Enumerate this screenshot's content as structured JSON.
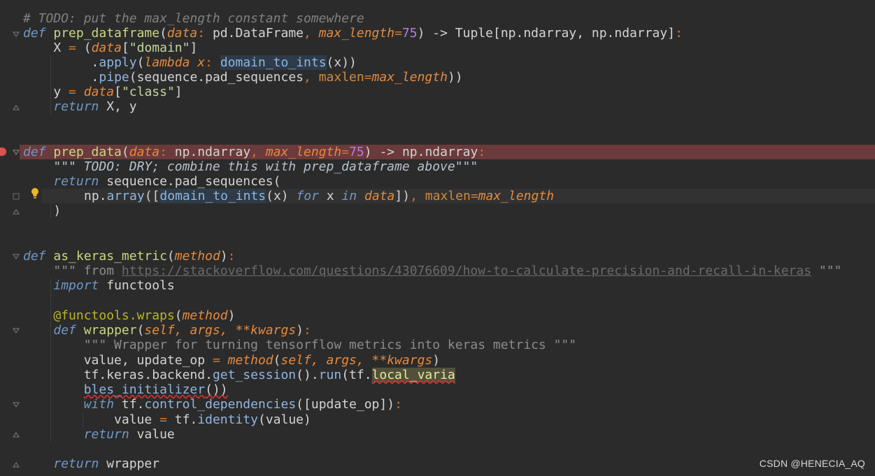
{
  "editor": {
    "lines": {
      "l1": "# TODO: put the max_length constant somewhere",
      "l2_def": "def",
      "l2_fn": "prep_dataframe",
      "l2_p1": "data",
      "l2_t1": "pd.DataFrame",
      "l2_p2": "max_length",
      "l2_v2": "75",
      "l2_ret": "Tuple[np.ndarray, np.ndarray]",
      "l3_var": "X",
      "l3_arg": "data",
      "l3_str": "\"domain\"",
      "l4_meth": "apply",
      "l4_kw": "lambda",
      "l4_x": "x",
      "l4_fn": "domain_to_ints",
      "l5_meth": "pipe",
      "l5_arg": "sequence.pad_sequences",
      "l5_kw": "maxlen",
      "l5_val": "max_length",
      "l6_var": "y",
      "l6_arg": "data",
      "l6_str": "\"class\"",
      "l7_kw": "return",
      "l7_vals": "X, y",
      "l10_def": "def",
      "l10_fn": "prep_data",
      "l10_p1": "data",
      "l10_t1": "np.ndarray",
      "l10_p2": "max_length",
      "l10_v2": "75",
      "l10_ret": "np.ndarray",
      "l11_doc": "\"\"\" TODO: DRY; combine this with prep_dataframe above\"\"\"",
      "l12_kw": "return",
      "l12_call": "sequence.pad_sequences",
      "l13_np": "np",
      "l13_arr": "array",
      "l13_fn": "domain_to_ints",
      "l13_for": "for",
      "l13_in": "in",
      "l13_data": "data",
      "l13_kw": "maxlen",
      "l13_val": "max_length",
      "l14": ")",
      "l17_def": "def",
      "l17_fn": "as_keras_metric",
      "l17_p": "method",
      "l18_pre": "\"\"\" from ",
      "l18_link": "https://stackoverflow.com/questions/43076609/how-to-calculate-precision-and-recall-in-keras",
      "l18_post": " \"\"\"",
      "l19_kw": "import",
      "l19_mod": "functools",
      "l21_dec": "@functools.wraps",
      "l21_p": "method",
      "l22_def": "def",
      "l22_fn": "wrapper",
      "l22_params": "self, args, **kwargs",
      "l23_doc": "\"\"\" Wrapper for turning tensorflow metrics into keras metrics \"\"\"",
      "l24_vars": "value, update_op",
      "l24_call": "method",
      "l24_args": "self, args, **kwargs",
      "l25_pre": "tf.keras.backend.",
      "l25_m1": "get_session",
      "l25_m2": "run",
      "l25_tf": "tf.",
      "l25_warn": "local_varia",
      "l26_cont": "bles_initializer",
      "l27_kw": "with",
      "l27_tf": "tf.",
      "l27_m": "control_dependencies",
      "l27_arg": "[update_op]",
      "l28_var": "value",
      "l28_tf": "tf.",
      "l28_m": "identity",
      "l28_arg": "value",
      "l29_kw": "return",
      "l29_v": "value",
      "l31_kw": "return",
      "l31_v": "wrapper"
    }
  },
  "watermark": "CSDN @HENECIA_AQ"
}
